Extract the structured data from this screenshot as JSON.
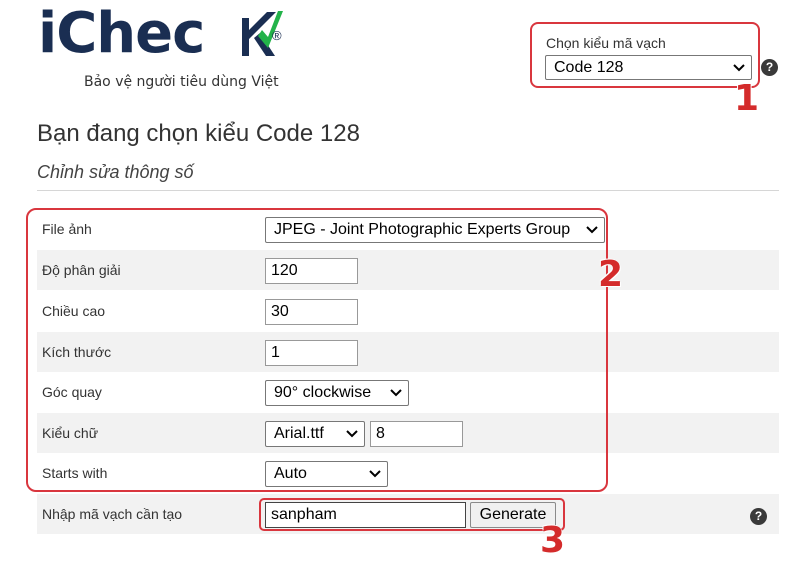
{
  "logo": {
    "wordmark_prefix": "iChec",
    "wordmark_reg": "®",
    "tagline": "Bảo vệ người tiêu dùng Việt",
    "brand_color": "#1a2e52",
    "accent_color": "#23b34a"
  },
  "barcode_type": {
    "label": "Chọn kiểu mã vạch",
    "selected": "Code 128",
    "help": "?"
  },
  "page_title": "Bạn đang chọn kiểu Code 128",
  "section_title": "Chỉnh sửa thông số",
  "fields": {
    "file": {
      "label": "File ảnh",
      "value": "JPEG - Joint Photographic Experts Group"
    },
    "resolution": {
      "label": "Độ phân giải",
      "value": "120"
    },
    "height": {
      "label": "Chiều cao",
      "value": "30"
    },
    "size": {
      "label": "Kích thước",
      "value": "1"
    },
    "rotation": {
      "label": "Góc quay",
      "value": "90° clockwise"
    },
    "font": {
      "label": "Kiểu chữ",
      "value": "Arial.ttf",
      "size": "8"
    },
    "starts_with": {
      "label": "Starts with",
      "value": "Auto"
    }
  },
  "generate": {
    "label": "Nhập mã vạch cần tạo",
    "value": "sanpham",
    "button": "Generate",
    "help": "?"
  },
  "annotations": {
    "one": "1",
    "two": "2",
    "three": "3",
    "color": "#d9363e"
  }
}
